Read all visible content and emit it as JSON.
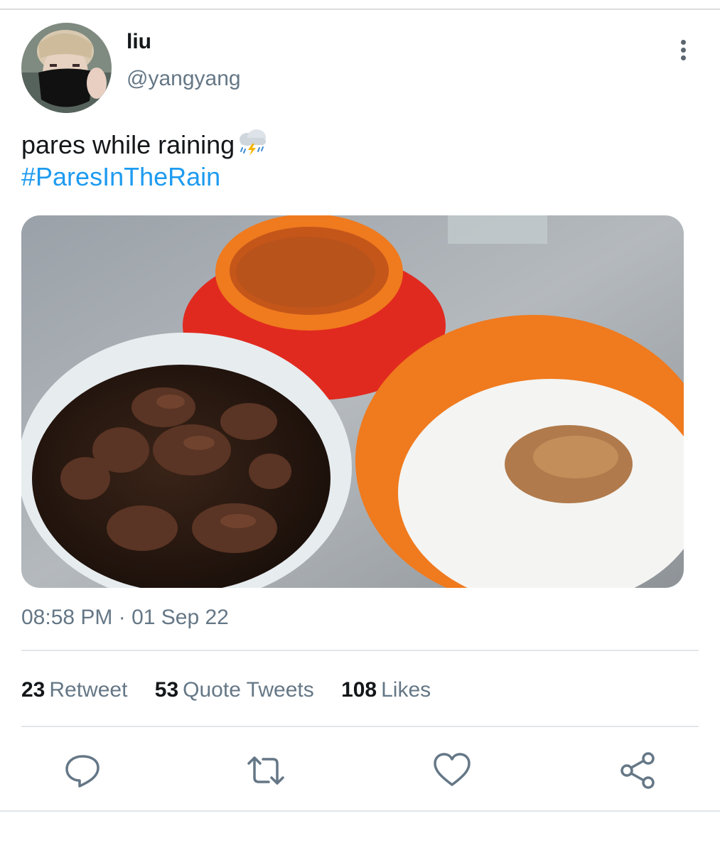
{
  "user": {
    "name": "liu",
    "handle": "@yangyang",
    "avatar_icon": "avatar-masked-person"
  },
  "tweet": {
    "text": "pares while raining",
    "emoji_icon": "cloud-with-lightning-and-rain-icon",
    "hashtag": "#ParesInTheRain",
    "timestamp": "08:58 PM · 01 Sep 22",
    "image_icon": "food-photo"
  },
  "stats": {
    "retweets": {
      "count": "23",
      "label": "Retweet"
    },
    "quotes": {
      "count": "53",
      "label": "Quote Tweets"
    },
    "likes": {
      "count": "108",
      "label": "Likes"
    }
  },
  "actions": [
    "reply-icon",
    "retweet-icon",
    "like-icon",
    "share-icon"
  ],
  "colors": {
    "link": "#1d9bf0",
    "secondary": "#657786",
    "icon": "#657786"
  }
}
